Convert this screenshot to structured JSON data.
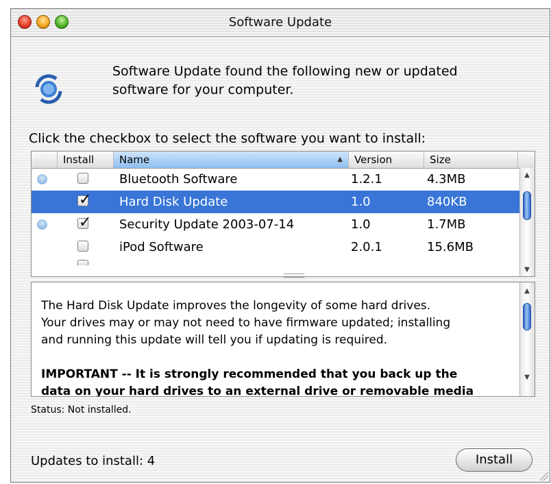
{
  "window": {
    "title": "Software Update"
  },
  "intro": {
    "line1": "Software Update found the following new or updated",
    "line2": "software for your computer."
  },
  "instruction": "Click the checkbox to select the software you want to install:",
  "list": {
    "columns": {
      "install": "Install",
      "name": "Name",
      "version": "Version",
      "size": "Size"
    },
    "sort": {
      "column": "Name",
      "direction": "ascending"
    },
    "rows": [
      {
        "name": "Bluetooth Software",
        "version": "1.2.1",
        "size": "4.3MB",
        "checked": false,
        "info": true,
        "selected": false
      },
      {
        "name": "Hard Disk Update",
        "version": "1.0",
        "size": "840KB",
        "checked": true,
        "info": false,
        "selected": true
      },
      {
        "name": "Security Update 2003-07-14",
        "version": "1.0",
        "size": "1.7MB",
        "checked": true,
        "info": true,
        "selected": false
      },
      {
        "name": "iPod Software",
        "version": "2.0.1",
        "size": "15.6MB",
        "checked": false,
        "info": false,
        "selected": false
      }
    ]
  },
  "description": {
    "line1": "The Hard Disk Update improves the longevity of some hard drives.",
    "line2": "Your drives may or may not need to have firmware updated; installing",
    "line3": "and running this update will tell you if updating is required.",
    "important1": "IMPORTANT -- It is strongly recommended that you back up the",
    "important2": "data on your hard drives to an external drive or removable media"
  },
  "status": "Status: Not installed.",
  "updates_count": "Updates to install: 4",
  "install_button": "Install",
  "colors": {
    "selection": "#3875d7",
    "scroll_thumb": "#4a86e0"
  }
}
